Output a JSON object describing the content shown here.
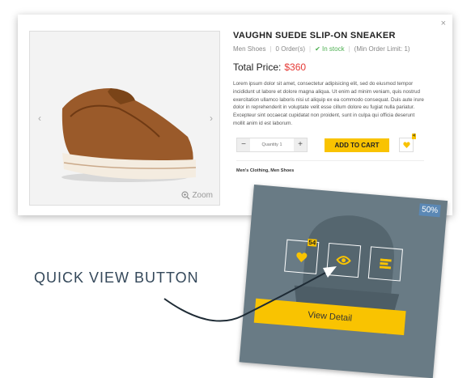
{
  "modal": {
    "close_label": "×",
    "product": {
      "title": "VAUGHN SUEDE SLIP-ON SNEAKER",
      "category": "Men Shoes",
      "orders": "0 Order(s)",
      "stock": "In stock",
      "order_limit": "(Min Order Limit: 1)",
      "price_label": "Total Price:",
      "price_value": "$360",
      "description": "Lorem ipsum dolor sit amet, consectetur adipisicing elit, sed do eiusmod tempor incididunt ut labore et dolore magna aliqua. Ut enim ad minim veniam, quis nostrud exercitation ullamco laboris nisi ut aliquip ex ea commodo consequat. Duis aute irure dolor in reprehenderit in voluptate velit esse cillum dolore eu fugiat nulla pariatur. Excepteur sint occaecat cupidatat non proident, sunt in culpa qui officia deserunt mollit anim id est laborum.",
      "quantity_placeholder": "Quantity 1",
      "add_to_cart": "ADD TO CART",
      "wishlist_count": "4",
      "categories_label": "Men's Clothing",
      "categories_value": "Men Shoes"
    },
    "gallery": {
      "prev": "‹",
      "next": "›",
      "zoom_label": "Zoom"
    }
  },
  "promo": {
    "discount_badge": "50%",
    "wishlist_count": "54",
    "view_detail": "View Detail"
  },
  "caption": "QUICK VIEW BUTTON",
  "colors": {
    "accent": "#f9c301",
    "price": "#e53935",
    "stock": "#4caf50",
    "panel": "#697b85",
    "caption": "#34485a"
  }
}
